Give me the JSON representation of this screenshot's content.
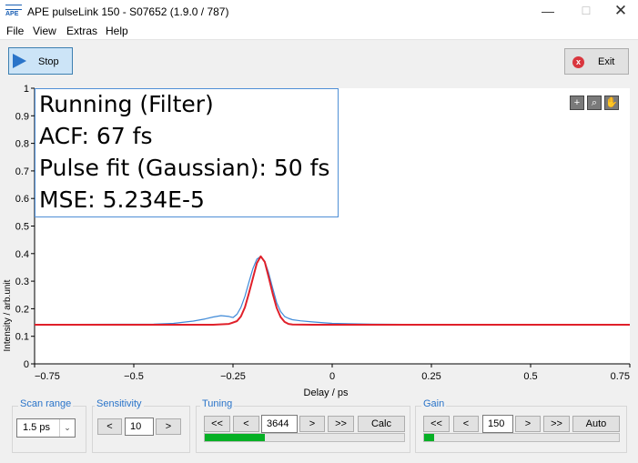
{
  "window": {
    "logo_text": "APE",
    "title": "APE pulseLink 150 - S07652 (1.9.0 / 787)",
    "minimize_glyph": "—",
    "maximize_glyph": "☐",
    "close_glyph": "✕"
  },
  "menu": [
    "File",
    "View",
    "Extras",
    "Help"
  ],
  "toolbar": {
    "stop_label": "Stop",
    "exit_label": "Exit",
    "exit_glyph": "x"
  },
  "plot": {
    "tools": [
      "+",
      "⌕",
      "✋"
    ],
    "info_lines": [
      "Running (Filter)",
      "ACF: 67 fs",
      "Pulse fit (Gaussian): 50 fs",
      "MSE: 5.234E-5"
    ]
  },
  "chart_data": {
    "type": "line",
    "xlabel": "Delay / ps",
    "ylabel": "Intensity / arb.unit",
    "xlim": [
      -0.75,
      0.75
    ],
    "ylim": [
      0,
      1
    ],
    "xticks": [
      -0.75,
      -0.5,
      -0.25,
      0,
      0.25,
      0.5,
      0.75
    ],
    "xtick_labels": [
      "−0.75",
      "−0.5",
      "−0.25",
      "0",
      "0.25",
      "0.5",
      "0.75"
    ],
    "yticks": [
      0,
      0.1,
      0.2,
      0.3,
      0.4,
      0.5,
      0.6,
      0.7,
      0.8,
      0.9,
      1
    ],
    "ytick_labels": [
      "0",
      "0.1",
      "0.2",
      "0.3",
      "0.4",
      "0.5",
      "0.6",
      "0.7",
      "0.8",
      "0.9",
      "1"
    ],
    "series": [
      {
        "color": "#3f8ad8",
        "x": [
          -0.75,
          -0.45,
          -0.4,
          -0.35,
          -0.32,
          -0.3,
          -0.28,
          -0.26,
          -0.25,
          -0.24,
          -0.23,
          -0.22,
          -0.21,
          -0.2,
          -0.19,
          -0.18,
          -0.17,
          -0.16,
          -0.15,
          -0.14,
          -0.13,
          -0.12,
          -0.11,
          -0.1,
          -0.08,
          -0.05,
          -0.02,
          0,
          0.1,
          0.3,
          0.5,
          0.75
        ],
        "y": [
          0.143,
          0.144,
          0.147,
          0.155,
          0.163,
          0.17,
          0.175,
          0.172,
          0.168,
          0.18,
          0.205,
          0.245,
          0.295,
          0.345,
          0.38,
          0.39,
          0.372,
          0.33,
          0.275,
          0.222,
          0.19,
          0.172,
          0.165,
          0.16,
          0.156,
          0.152,
          0.149,
          0.147,
          0.144,
          0.142,
          0.142,
          0.141
        ]
      },
      {
        "color": "#e0202a",
        "x": [
          -0.75,
          -0.45,
          -0.3,
          -0.26,
          -0.24,
          -0.23,
          -0.22,
          -0.21,
          -0.2,
          -0.19,
          -0.18,
          -0.17,
          -0.16,
          -0.15,
          -0.14,
          -0.13,
          -0.12,
          -0.11,
          -0.1,
          -0.05,
          0.1,
          0.3,
          0.5,
          0.75
        ],
        "y": [
          0.142,
          0.142,
          0.142,
          0.145,
          0.155,
          0.172,
          0.205,
          0.255,
          0.31,
          0.365,
          0.39,
          0.37,
          0.315,
          0.255,
          0.203,
          0.17,
          0.152,
          0.145,
          0.143,
          0.142,
          0.142,
          0.142,
          0.142,
          0.142
        ]
      }
    ]
  },
  "scan_range": {
    "label": "Scan range",
    "value": "1.5 ps",
    "arrow": "⌄"
  },
  "sensitivity": {
    "label": "Sensitivity",
    "dec": "<",
    "value": "10",
    "inc": ">"
  },
  "tuning": {
    "label": "Tuning",
    "buttons": [
      "<<",
      "<",
      ">",
      ">>"
    ],
    "value": "3644",
    "calc": "Calc",
    "progress": 0.3
  },
  "gain": {
    "label": "Gain",
    "buttons": [
      "<<",
      "<",
      ">",
      ">>"
    ],
    "value": "150",
    "auto": "Auto",
    "progress": 0.05
  }
}
